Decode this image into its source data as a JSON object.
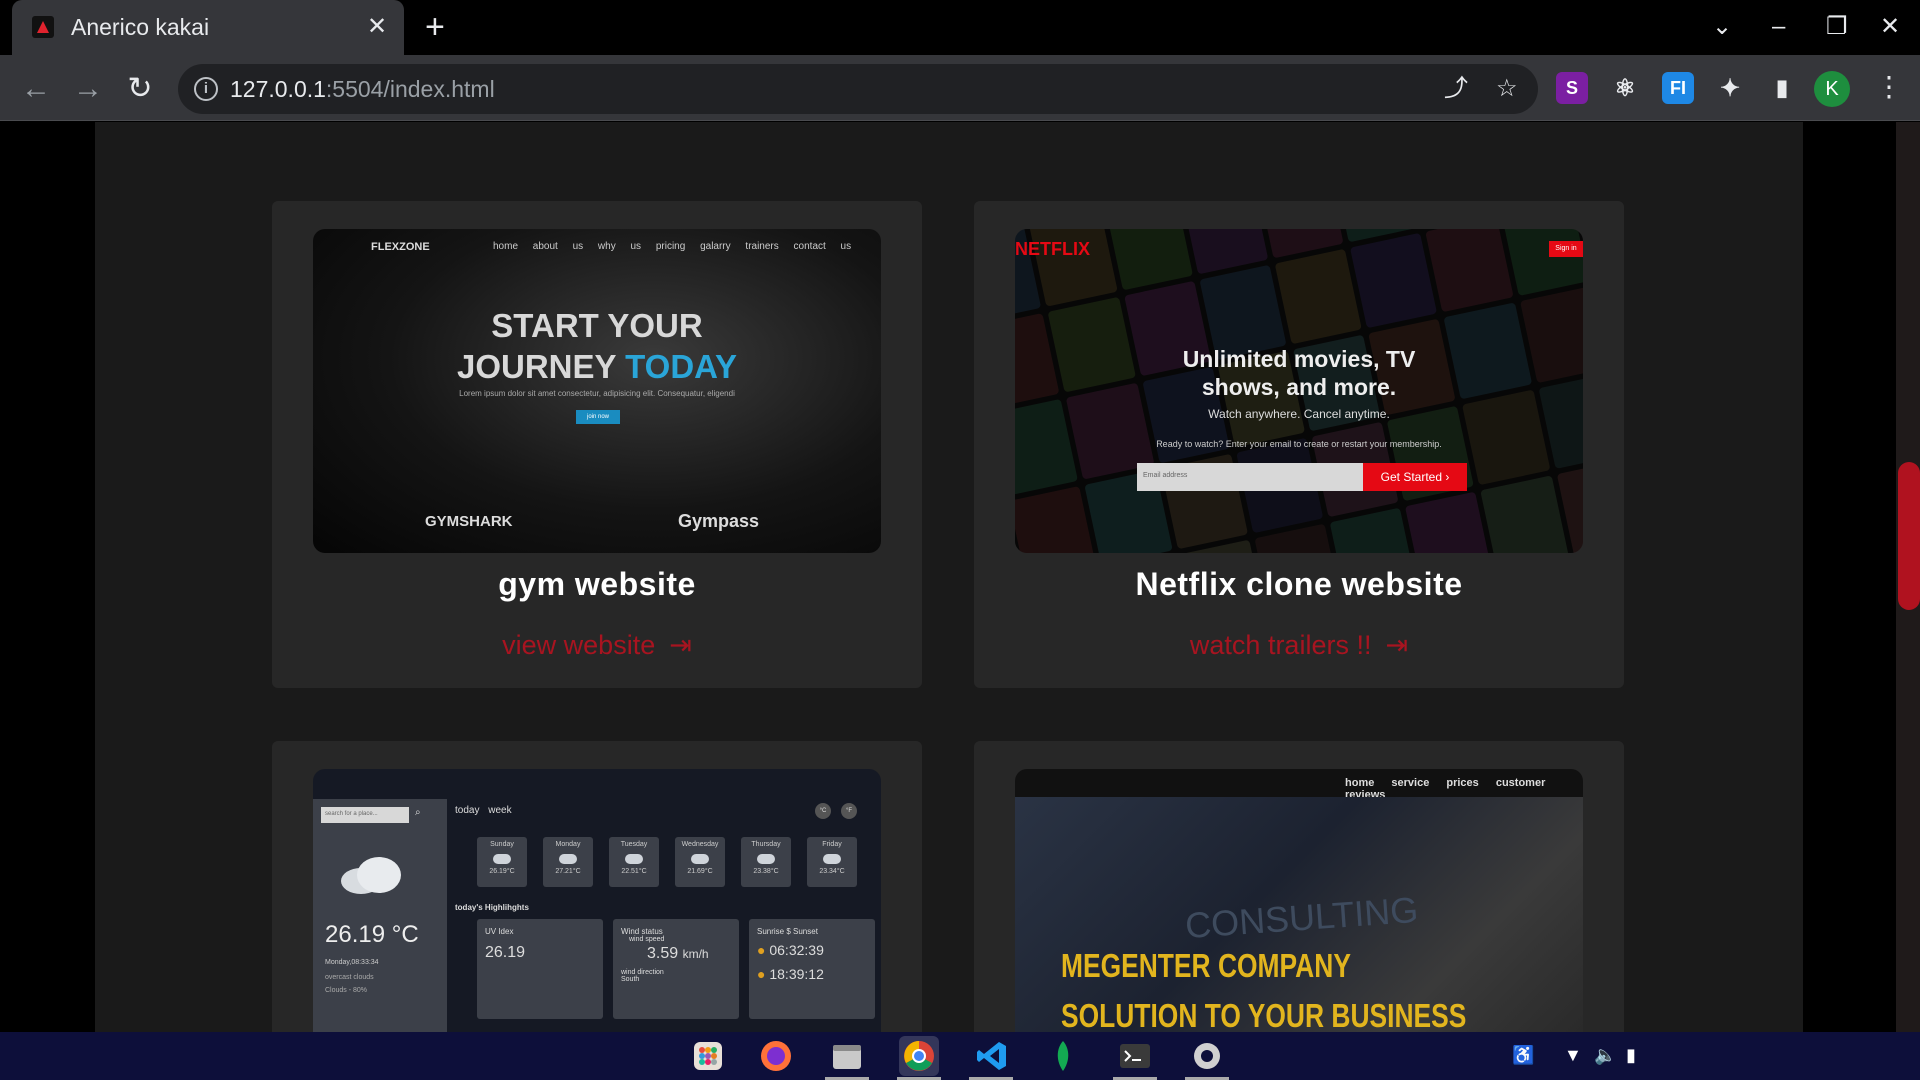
{
  "browser": {
    "tab_title": "Anerico kakai",
    "tab_close": "✕",
    "new_tab": "+",
    "url_host": "127.0.0.1",
    "url_path": ":5504/index.html",
    "avatar_letter": "K",
    "icons": [
      "back-icon",
      "forward-icon",
      "reload-icon",
      "info-icon",
      "share-icon",
      "star-icon",
      "extension-icon",
      "sidepanel-icon",
      "menu-icon"
    ]
  },
  "projects": [
    {
      "title": "gym website",
      "link": "view website",
      "shot": {
        "logo": "FLEXZONE",
        "nav": "home about us why us pricing galarry trainers contact us",
        "headline_1": "START YOUR",
        "headline_2a": "JOURNEY",
        "headline_2b": "TODAY",
        "sub": "Lorem ipsum dolor sit amet consectetur, adipisicing elit. Consequatur, eligendi",
        "button": "join now",
        "brand_1": "GYMSHARK",
        "brand_2": "Gympass"
      }
    },
    {
      "title": "Netflix clone website",
      "link": "watch trailers !!",
      "shot": {
        "logo": "NETFLIX",
        "signin": "Sign in",
        "headline": "Unlimited movies, TV shows, and more.",
        "sub": "Watch anywhere. Cancel anytime.",
        "prompt": "Ready to watch? Enter your email to create or restart your membership.",
        "email_placeholder": "Email address",
        "cta": "Get Started ›"
      }
    },
    {
      "title": "",
      "link": "",
      "shot": {
        "search_placeholder": "search for a place...",
        "temp": "26.19 °C",
        "date": "Monday,08:33:34",
        "condition": "overcast clouds",
        "clouds": "Clouds - 80%",
        "tabs": "today week",
        "unit_c": "°C",
        "unit_f": "°F",
        "days": [
          {
            "name": "Sunday",
            "temp": "26.19°C"
          },
          {
            "name": "Monday",
            "temp": "27.21°C"
          },
          {
            "name": "Tuesday",
            "temp": "22.51°C"
          },
          {
            "name": "Wednesday",
            "temp": "21.69°C"
          },
          {
            "name": "Thursday",
            "temp": "23.38°C"
          },
          {
            "name": "Friday",
            "temp": "23.34°C"
          }
        ],
        "highlights": "today's Highlihghts",
        "uv_label": "UV Idex",
        "uv_value": "26.19",
        "wind_label": "Wind status",
        "wind_sub": "wind speed",
        "wind_value": "3.59",
        "wind_unit": "km/h",
        "wind_dir_label": "wind direction",
        "wind_dir": "South",
        "sun_label": "Sunrise $ Sunset",
        "sunrise": "06:32:39",
        "sunset": "18:39:12"
      }
    },
    {
      "title": "",
      "link": "",
      "shot": {
        "nav": "home service prices customer reviews",
        "hero_word": "CONSULTING",
        "brand": "MEGENTER COMPANY",
        "tagline": "SOLUTION TO YOUR BUSINESS"
      }
    }
  ],
  "colors": {
    "accent_red": "#a81420",
    "page_bg": "#1a1a1a",
    "card_bg": "#272727",
    "scroll_thumb": "#b0121f"
  },
  "taskbar": {
    "apps": [
      "launcher-icon",
      "firefox-icon",
      "files-icon",
      "chrome-icon",
      "vscode-icon",
      "mongodb-icon",
      "terminal-icon",
      "settings-icon"
    ]
  }
}
